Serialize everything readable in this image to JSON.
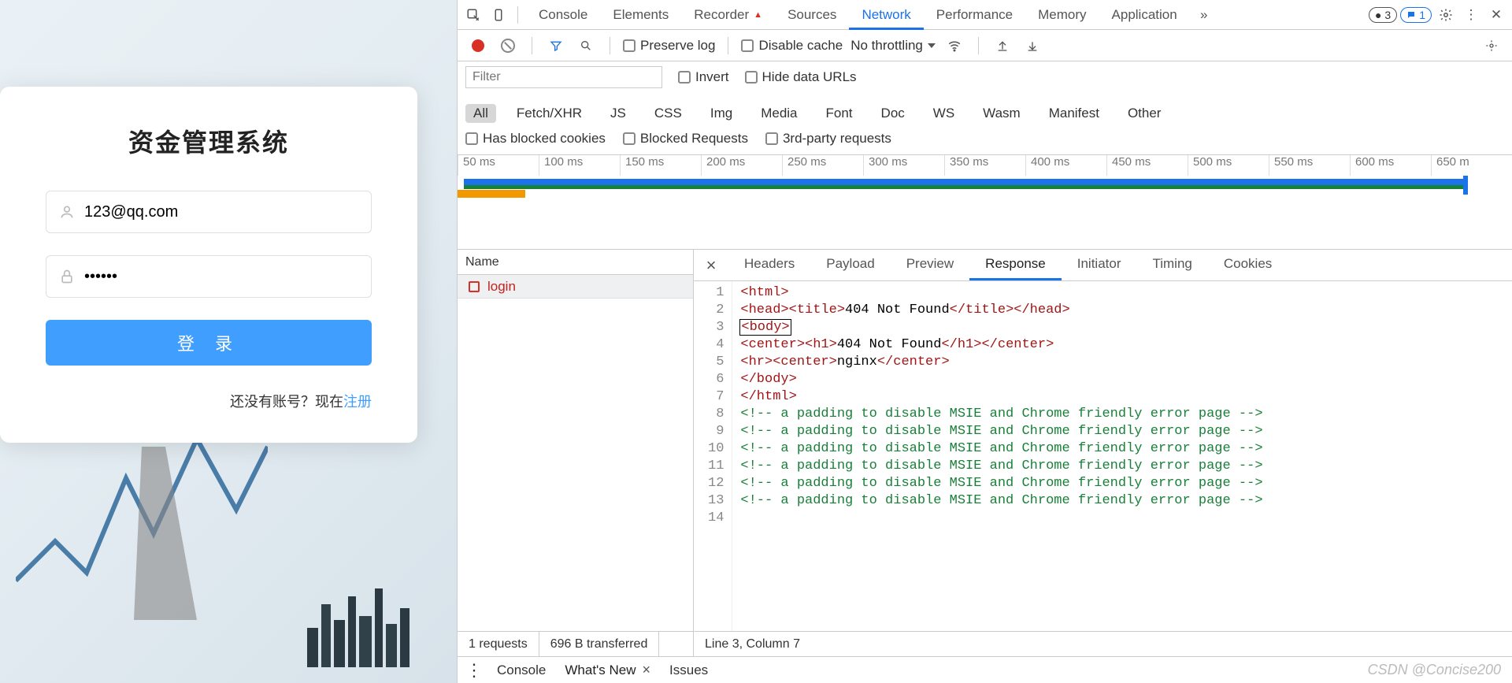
{
  "login": {
    "title": "资金管理系统",
    "email_value": "123@qq.com",
    "password_value": "••••••",
    "button_label": "登 录",
    "register_prompt": "还没有账号？现在",
    "register_link": "注册"
  },
  "devtools": {
    "top_tabs": [
      "Console",
      "Elements",
      "Recorder",
      "Sources",
      "Network",
      "Performance",
      "Memory",
      "Application"
    ],
    "top_active": "Network",
    "more_icon": "»",
    "error_count": "3",
    "issue_count": "1",
    "tb2": {
      "preserve_log": "Preserve log",
      "disable_cache": "Disable cache",
      "throttling": "No throttling"
    },
    "tb3": {
      "filter_placeholder": "Filter",
      "invert": "Invert",
      "hide_data_urls": "Hide data URLs",
      "types": [
        "All",
        "Fetch/XHR",
        "JS",
        "CSS",
        "Img",
        "Media",
        "Font",
        "Doc",
        "WS",
        "Wasm",
        "Manifest",
        "Other"
      ],
      "type_active": "All"
    },
    "tb4": {
      "blocked_cookies": "Has blocked cookies",
      "blocked_requests": "Blocked Requests",
      "third_party": "3rd-party requests"
    },
    "timeline_ticks": [
      "50 ms",
      "100 ms",
      "150 ms",
      "200 ms",
      "250 ms",
      "300 ms",
      "350 ms",
      "400 ms",
      "450 ms",
      "500 ms",
      "550 ms",
      "600 ms",
      "650 m"
    ],
    "req_header": "Name",
    "requests": [
      {
        "name": "login"
      }
    ],
    "detail_tabs": [
      "Headers",
      "Payload",
      "Preview",
      "Response",
      "Initiator",
      "Timing",
      "Cookies"
    ],
    "detail_active": "Response",
    "code_lines": [
      [
        {
          "c": "tag",
          "t": "<html>"
        }
      ],
      [
        {
          "c": "tag",
          "t": "<head><title>"
        },
        {
          "c": "txt",
          "t": "404 Not Found"
        },
        {
          "c": "tag",
          "t": "</title></head>"
        }
      ],
      [
        {
          "c": "tag",
          "t": "<body>"
        }
      ],
      [
        {
          "c": "tag",
          "t": "<center><h1>"
        },
        {
          "c": "txt",
          "t": "404 Not Found"
        },
        {
          "c": "tag",
          "t": "</h1></center>"
        }
      ],
      [
        {
          "c": "tag",
          "t": "<hr><center>"
        },
        {
          "c": "txt",
          "t": "nginx"
        },
        {
          "c": "tag",
          "t": "</center>"
        }
      ],
      [
        {
          "c": "tag",
          "t": "</body>"
        }
      ],
      [
        {
          "c": "tag",
          "t": "</html>"
        }
      ],
      [
        {
          "c": "cmt",
          "t": "<!-- a padding to disable MSIE and Chrome friendly error page -->"
        }
      ],
      [
        {
          "c": "cmt",
          "t": "<!-- a padding to disable MSIE and Chrome friendly error page -->"
        }
      ],
      [
        {
          "c": "cmt",
          "t": "<!-- a padding to disable MSIE and Chrome friendly error page -->"
        }
      ],
      [
        {
          "c": "cmt",
          "t": "<!-- a padding to disable MSIE and Chrome friendly error page -->"
        }
      ],
      [
        {
          "c": "cmt",
          "t": "<!-- a padding to disable MSIE and Chrome friendly error page -->"
        }
      ],
      [
        {
          "c": "cmt",
          "t": "<!-- a padding to disable MSIE and Chrome friendly error page -->"
        }
      ],
      [
        {
          "c": "txt",
          "t": ""
        }
      ]
    ],
    "cursor_line": 3,
    "status_left": [
      "1 requests",
      "696 B transferred"
    ],
    "status_right": "Line 3, Column 7",
    "drawer_tabs": [
      "Console",
      "What's New",
      "Issues"
    ],
    "drawer_active": "What's New",
    "watermark": "CSDN @Concise200"
  }
}
